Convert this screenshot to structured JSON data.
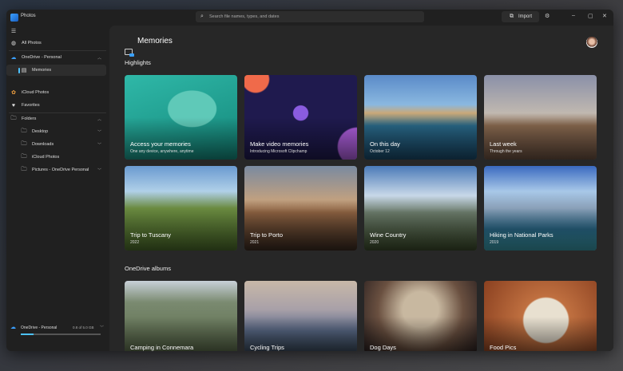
{
  "app": {
    "title": "Photos"
  },
  "search": {
    "placeholder": "Search file names, types, and dates"
  },
  "toolbar": {
    "import_label": "Import",
    "settings_icon": "gear-icon"
  },
  "sidebar": {
    "items": [
      {
        "label": "All Photos",
        "icon": "photos-icon"
      },
      {
        "label": "OneDrive - Personal",
        "icon": "cloud-icon"
      },
      {
        "label": "Memories",
        "icon": "memories-icon"
      },
      {
        "label": "iCloud Photos",
        "icon": "icloud-icon"
      },
      {
        "label": "Favorites",
        "icon": "heart-icon"
      },
      {
        "label": "Folders",
        "icon": "folder-icon"
      },
      {
        "label": "Desktop",
        "icon": "folder-icon"
      },
      {
        "label": "Downloads",
        "icon": "folder-icon"
      },
      {
        "label": "iCloud Photos",
        "icon": "folder-icon"
      },
      {
        "label": "Pictures - OneDrive Personal",
        "icon": "folder-icon"
      }
    ],
    "storage": {
      "label": "OneDrive - Personal",
      "usage": "0.8 of 5.0 GB",
      "fraction": 0.16
    }
  },
  "main": {
    "title": "Memories",
    "highlights_heading": "Highlights",
    "albums_heading": "OneDrive albums",
    "highlights": [
      {
        "title": "Access your memories",
        "subtitle": "One any device, anywhere, anytime"
      },
      {
        "title": "Make video memories",
        "subtitle": "Introducing Microsoft Clipchamp"
      },
      {
        "title": "On this day",
        "subtitle": "October 12"
      },
      {
        "title": "Last week",
        "subtitle": "Through the years"
      },
      {
        "title": "Trip to Tuscany",
        "subtitle": "2022"
      },
      {
        "title": "Trip to Porto",
        "subtitle": "2021"
      },
      {
        "title": "Wine Country",
        "subtitle": "2020"
      },
      {
        "title": "Hiking in National Parks",
        "subtitle": "2019"
      }
    ],
    "albums": [
      {
        "title": "Camping in Connemara"
      },
      {
        "title": "Cycling Trips"
      },
      {
        "title": "Dog Days"
      },
      {
        "title": "Food Pics"
      }
    ]
  },
  "colors": {
    "accent": "#4cc2ff",
    "background": "#202020"
  }
}
